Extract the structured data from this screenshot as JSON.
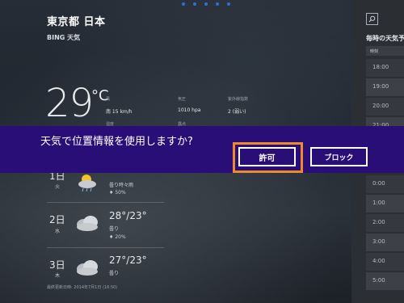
{
  "header": {
    "location": "東京都 日本",
    "provider": "BING 天気"
  },
  "current": {
    "temperature": "29",
    "unit": "°C",
    "stats": [
      {
        "label": "風",
        "value": "南 15 km/h"
      },
      {
        "label": "気圧",
        "value": "1010 hpa"
      },
      {
        "label": "紫外線指数",
        "value": "2 (弱い)"
      }
    ],
    "stats_row2": [
      "湿度",
      "露点"
    ]
  },
  "hourly": {
    "title": "毎時の天気予",
    "column_header": "時刻",
    "hours": [
      "18:00",
      "19:00",
      "20:00",
      "21:00",
      "0:00",
      "1:00",
      "2:00",
      "3:00",
      "4:00",
      "5:00"
    ]
  },
  "forecast": [
    {
      "day": "1日",
      "weekday": "火",
      "temps": "",
      "condition": "曇り時々雨",
      "precip": "50%",
      "icon": "sun-cloud-rain-icon"
    },
    {
      "day": "2日",
      "weekday": "水",
      "temps": "28°/23°",
      "condition": "曇り",
      "precip": "20%",
      "icon": "cloud-icon"
    },
    {
      "day": "3日",
      "weekday": "木",
      "temps": "27°/23°",
      "condition": "曇り",
      "precip": "",
      "icon": "cloud-icon"
    }
  ],
  "updated": "最終更新日時: 2014年7月1日 (16:50)",
  "permission": {
    "message": "天気で位置情報を使用しますか?",
    "allow_label": "許可",
    "block_label": "ブロック"
  },
  "colors": {
    "banner": "#2a0e78",
    "focus_outline": "#ef8a2a",
    "page_dots": "#2f6fd6"
  }
}
